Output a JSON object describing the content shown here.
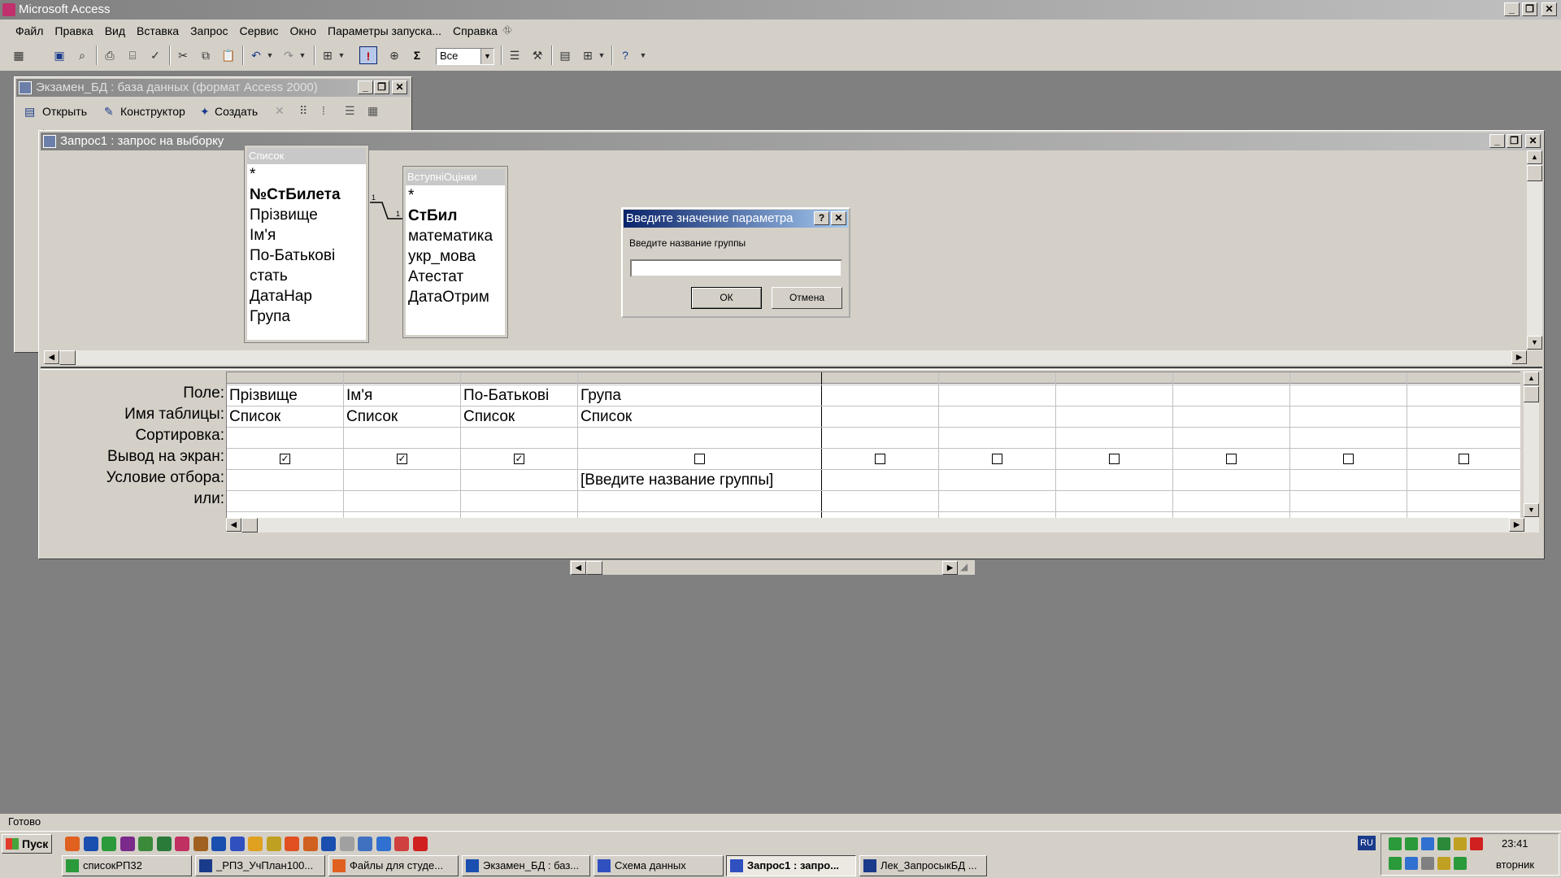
{
  "app": {
    "title": "Microsoft Access",
    "menu": [
      "Файл",
      "Правка",
      "Вид",
      "Вставка",
      "Запрос",
      "Сервис",
      "Окно",
      "Параметры запуска...",
      "Справка"
    ],
    "toolbar": {
      "combo_value": "Все",
      "sigma": "Σ"
    },
    "status": "Готово"
  },
  "db_window": {
    "title": "Экзамен_БД : база данных (формат Access 2000)",
    "open_label": "Открыть",
    "design_label": "Конструктор",
    "create_label": "Создать"
  },
  "query_window": {
    "title": "Запрос1 : запрос на выборку",
    "tables": [
      {
        "name": "Список",
        "fields": [
          "*",
          "№СтБилета",
          "Прізвище",
          "Ім'я",
          "По-Батькові",
          "стать",
          "ДатаНар",
          "Група"
        ],
        "key_field": "№СтБилета"
      },
      {
        "name": "ВступніОцінки",
        "fields": [
          "*",
          "СтБил",
          "математика",
          "укр_мова",
          "Атестат",
          "ДатаОтрим"
        ],
        "key_field": "СтБил"
      }
    ],
    "relation_labels": [
      "1",
      "1"
    ],
    "grid_labels": [
      "Поле:",
      "Имя таблицы:",
      "Сортировка:",
      "Вывод на экран:",
      "Условие отбора:",
      "или:"
    ],
    "columns": [
      {
        "field": "Прізвище",
        "table": "Список",
        "show": true,
        "criteria": ""
      },
      {
        "field": "Ім'я",
        "table": "Список",
        "show": true,
        "criteria": ""
      },
      {
        "field": "По-Батькові",
        "table": "Список",
        "show": true,
        "criteria": ""
      },
      {
        "field": "Група",
        "table": "Список",
        "show": false,
        "criteria": "[Введите название группы]"
      },
      {
        "field": "",
        "table": "",
        "show": false,
        "criteria": ""
      },
      {
        "field": "",
        "table": "",
        "show": false,
        "criteria": ""
      },
      {
        "field": "",
        "table": "",
        "show": false,
        "criteria": ""
      },
      {
        "field": "",
        "table": "",
        "show": false,
        "criteria": ""
      },
      {
        "field": "",
        "table": "",
        "show": false,
        "criteria": ""
      },
      {
        "field": "",
        "table": "",
        "show": false,
        "criteria": ""
      }
    ]
  },
  "dialog": {
    "title": "Введите значение параметра",
    "prompt": "Введите название группы",
    "value": "",
    "ok": "ОК",
    "cancel": "Отмена"
  },
  "taskbar": {
    "start": "Пуск",
    "lang": "RU",
    "time": "23:41",
    "day": "вторник",
    "tasks": [
      "списокРП32",
      "_РПЗ_УчПлан100...",
      "Файлы для студе...",
      "Экзамен_БД : баз...",
      "Схема данных",
      "Запрос1 : запро...",
      "Лек_ЗапросыкБД ..."
    ],
    "active_task": 5
  },
  "colors": {
    "title_active": "#0a246a",
    "title_inactive": "#808080",
    "face": "#d4d0c8",
    "desktop": "#808080"
  }
}
